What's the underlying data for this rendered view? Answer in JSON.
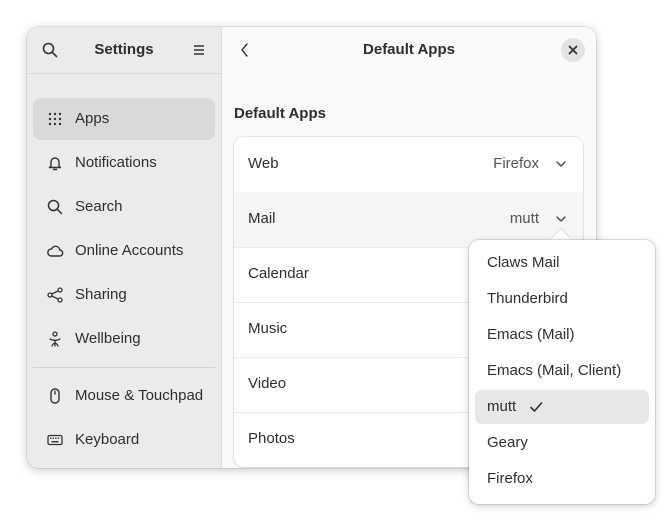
{
  "sidebar": {
    "title": "Settings",
    "items": [
      {
        "label": "Apps",
        "icon": "apps-grid-icon"
      },
      {
        "label": "Notifications",
        "icon": "bell-icon"
      },
      {
        "label": "Search",
        "icon": "search-icon"
      },
      {
        "label": "Online Accounts",
        "icon": "cloud-icon"
      },
      {
        "label": "Sharing",
        "icon": "share-icon"
      },
      {
        "label": "Wellbeing",
        "icon": "wellbeing-icon"
      },
      {
        "label": "Mouse & Touchpad",
        "icon": "mouse-icon"
      },
      {
        "label": "Keyboard",
        "icon": "keyboard-icon"
      }
    ],
    "selected": "Apps"
  },
  "content": {
    "title": "Default Apps",
    "section_title": "Default Apps",
    "rows": [
      {
        "label": "Web",
        "value": "Firefox"
      },
      {
        "label": "Mail",
        "value": "mutt"
      },
      {
        "label": "Calendar",
        "value": ""
      },
      {
        "label": "Music",
        "value": ""
      },
      {
        "label": "Video",
        "value": ""
      },
      {
        "label": "Photos",
        "value": ""
      }
    ]
  },
  "popover": {
    "options": [
      "Claws Mail",
      "Thunderbird",
      "Emacs (Mail)",
      "Emacs (Mail, Client)",
      "mutt",
      "Geary",
      "Firefox"
    ],
    "selected": "mutt"
  },
  "colors": {
    "sidebar_bg": "#ebebed",
    "content_bg": "#fafafa",
    "selected_bg": "#d9d9db"
  }
}
